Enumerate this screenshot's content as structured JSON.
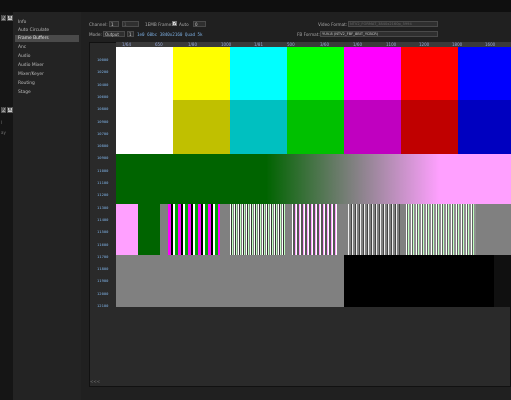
{
  "left_strip": {
    "badge_a": "K",
    "badge_b": "X",
    "label_a": "I",
    "label_b": "ay"
  },
  "sidebar": {
    "items": [
      "Info",
      "Auto Circulate",
      "Frame Buffers",
      "Anc",
      "Audio",
      "Audio Mixer",
      "Mixer/Keyer",
      "Routing",
      "Stage"
    ],
    "active_index": 2
  },
  "toolbar": {
    "channel_label": "Channel:",
    "channel_value": "1",
    "channel_count": "1",
    "ebmb_label": "1EMB Frame:",
    "auto_label": "Auto",
    "auto_checked": true,
    "frame_value": "0",
    "mode_label": "Mode:",
    "mode_value": "Output",
    "mode_number": "1",
    "hex_readout": "1e0 60bc 3840x2160 Quad 5k",
    "video_format_label": "Video Format:",
    "video_format_value": "NTV2_FORMAT_3840x2160p_5994",
    "fb_format_label": "FB Format:",
    "fb_format_value": "YUV-8 (NTV2_FBF_8BIT_YCBCR)"
  },
  "ruler_ticks": [
    "1/64",
    "650",
    "1/80",
    "1000",
    "1/81",
    "500",
    "3/60",
    "1/60",
    "1100",
    "1200",
    "1800",
    "1600"
  ],
  "y_ticks": [
    "10000",
    "10200",
    "10400",
    "10600",
    "10800",
    "10900",
    "10700",
    "10800",
    "10900",
    "11000",
    "11100",
    "11200",
    "11300",
    "11400",
    "11500",
    "11600",
    "11700",
    "11800",
    "11900",
    "12000",
    "12100"
  ],
  "colors": {
    "top_bars": [
      "#ffffff",
      "#ffff00",
      "#00ffff",
      "#00ff00",
      "#ff00ff",
      "#ff0000",
      "#0000ff"
    ],
    "mid_bars": [
      "#ffffff",
      "#c0c000",
      "#00c0c0",
      "#00c000",
      "#c000c0",
      "#c00000",
      "#0000c0"
    ],
    "green_band": "#006400",
    "pink": "#ffa0ff",
    "gray": "#808080",
    "black": "#000000"
  },
  "status_text": "<<<"
}
